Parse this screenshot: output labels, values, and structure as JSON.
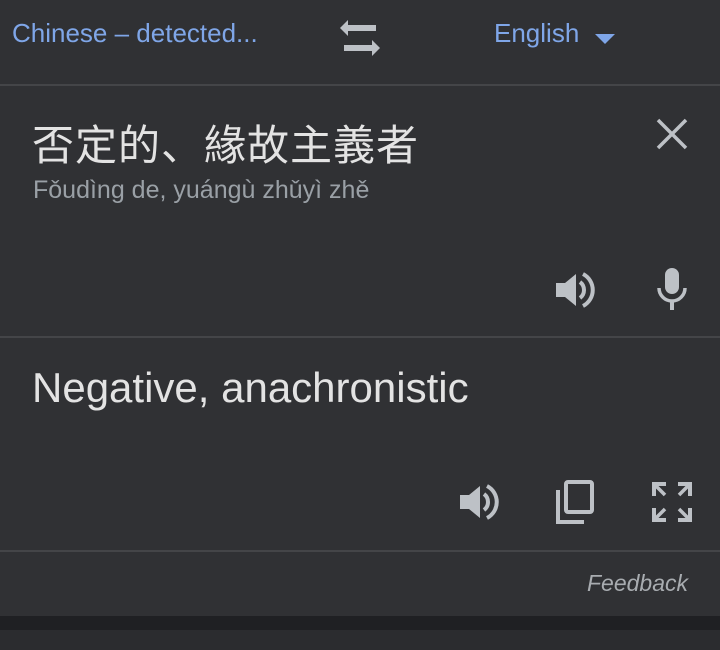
{
  "language_bar": {
    "source_language": "Chinese – detected...",
    "target_language": "English"
  },
  "source": {
    "text": "否定的、緣故主義者",
    "romanization": "Fǒudìng de, yuángù zhǔyì zhě"
  },
  "translation": {
    "text": "Negative, anachronistic"
  },
  "footer": {
    "feedback_label": "Feedback"
  },
  "icons": {
    "swap": "swap-languages-icon",
    "dropdown": "caret-down-icon",
    "clear": "close-icon",
    "speak": "speaker-icon",
    "mic": "microphone-icon",
    "copy": "copy-icon",
    "fullscreen": "fullscreen-icon"
  },
  "colors": {
    "background": "#303134",
    "accent": "#7fa6e8",
    "text_primary": "#e3e3e3",
    "text_secondary": "#9aa0a6",
    "icon": "#bdc1c6",
    "divider": "#444548"
  }
}
